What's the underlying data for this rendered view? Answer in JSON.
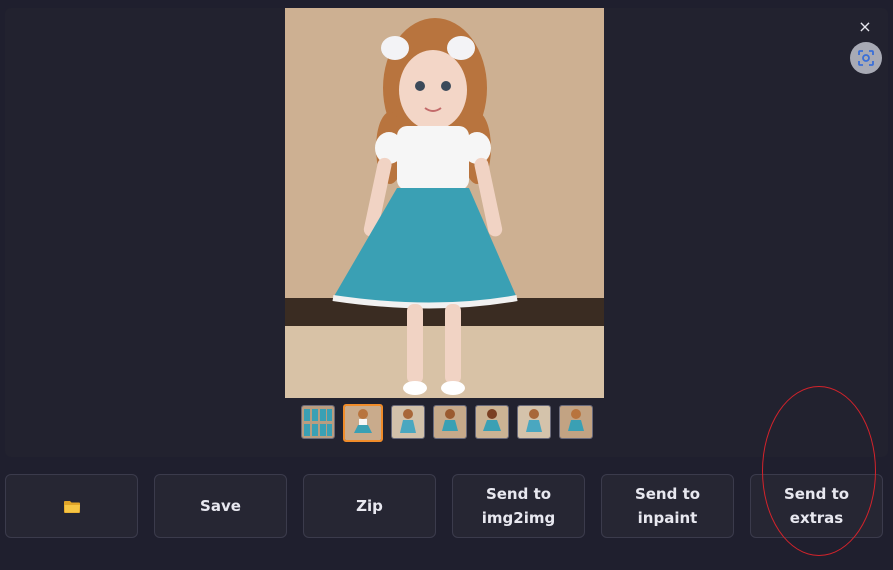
{
  "gallery": {
    "close_label": "×",
    "selected_index": 1,
    "thumbnails": [
      {
        "name": "thumbnail-grid"
      },
      {
        "name": "thumbnail-1"
      },
      {
        "name": "thumbnail-2"
      },
      {
        "name": "thumbnail-3"
      },
      {
        "name": "thumbnail-4"
      },
      {
        "name": "thumbnail-5"
      },
      {
        "name": "thumbnail-6"
      }
    ]
  },
  "actions": {
    "folder_icon": "folder-icon",
    "save_label": "Save",
    "zip_label": "Zip",
    "img2img_label": "Send to\nimg2img",
    "inpaint_label": "Send to inpaint",
    "extras_label": "Send to extras"
  },
  "colors": {
    "background": "#1f1f2e",
    "button_bg": "#262633",
    "selected_border": "#f08c2a",
    "annotation": "#d3232b"
  }
}
